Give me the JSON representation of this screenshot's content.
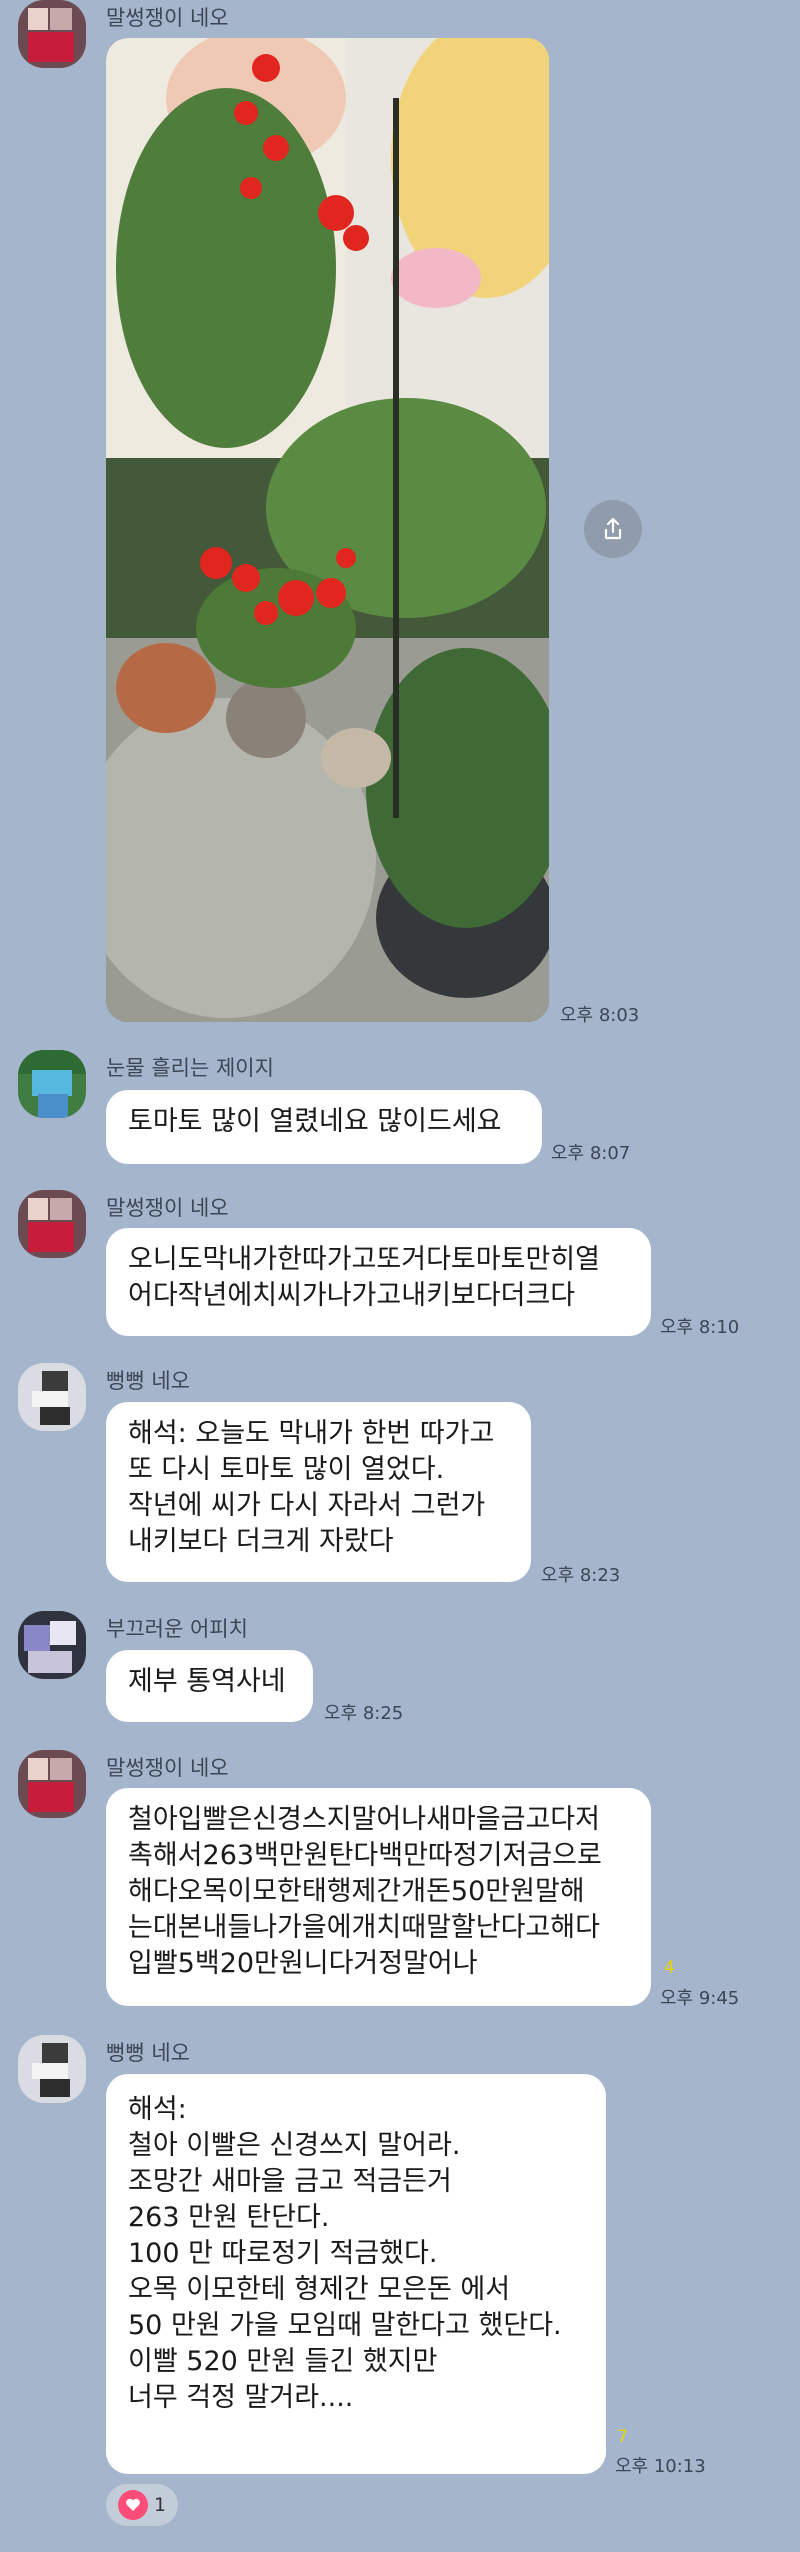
{
  "messages": [
    {
      "sender": "말썽쟁이 네오",
      "type": "photo",
      "time": "오후 8:03"
    },
    {
      "sender": "눈물 흘리는 제이지",
      "text": "토마토 많이 열렸네요 많이드세요",
      "time": "오후 8:07"
    },
    {
      "sender": "말썽쟁이 네오",
      "text": "오니도막내가한따가고또거다토마토만히열\n어다작년에치씨가나가고내키보다더크다",
      "time": "오후 8:10"
    },
    {
      "sender": "뻥뻥 네오",
      "text": "해석: 오늘도 막내가 한번 따가고\n또 다시 토마토  많이 열었다.\n작년에 씨가 다시 자라서 그런가\n내키보다 더크게 자랐다",
      "time": "오후 8:23"
    },
    {
      "sender": "부끄러운 어피치",
      "text": "제부 통역사네",
      "time": "오후 8:25"
    },
    {
      "sender": "말썽쟁이 네오",
      "text": "철아입빨은신경스지말어나새마을금고다저\n촉해서263백만원탄다백만따정기저금으로\n해다오목이모한태행제간개돈50만원말해\n는대본내들나가을에개치때말할난다고해다\n입빨5백20만원니다거정말어나",
      "time": "오후 9:45",
      "unread": "4"
    },
    {
      "sender": "뻥뻥 네오",
      "text": "해석:\n 철아 이빨은 신경쓰지 말어라.\n조망간 새마을 금고 적금든거\n263 만원 탄단다.\n100 만 따로정기 적금했다.\n오목 이모한테 형제간 모은돈 에서\n50 만원 가을 모임때 말한다고 했단다.\n이빨 520 만원 들긴 했지만\n너무 걱정 말거라....",
      "time": "오후 10:13",
      "unread": "7"
    }
  ],
  "reaction": {
    "icon": "heart-icon",
    "count": "1"
  },
  "icons": {
    "share": "share-icon"
  },
  "colors": {
    "background": "#a5b5cc",
    "bubble": "#ffffff",
    "unread": "#e8d400",
    "heart": "#ff4d7a"
  }
}
